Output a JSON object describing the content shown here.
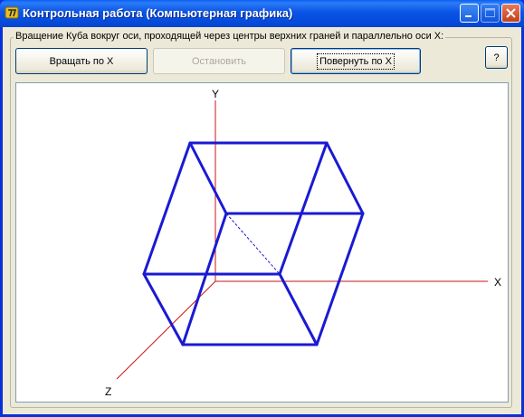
{
  "window": {
    "title": "Контрольная работа (Компьютерная графика)"
  },
  "group": {
    "caption": "Вращение Куба вокруг оси, проходящей через центры верхних граней и параллельно оси X:"
  },
  "buttons": {
    "rotate": "Вращать по X",
    "stop": "Остановить",
    "turn": "Повернуть по X",
    "help": "?"
  },
  "axes": {
    "x": "X",
    "y": "Y",
    "z": "Z"
  },
  "colors": {
    "cube_edges": "#1a1ad4",
    "axes": "#c81414",
    "hidden_edge": "#1a1ad4"
  }
}
